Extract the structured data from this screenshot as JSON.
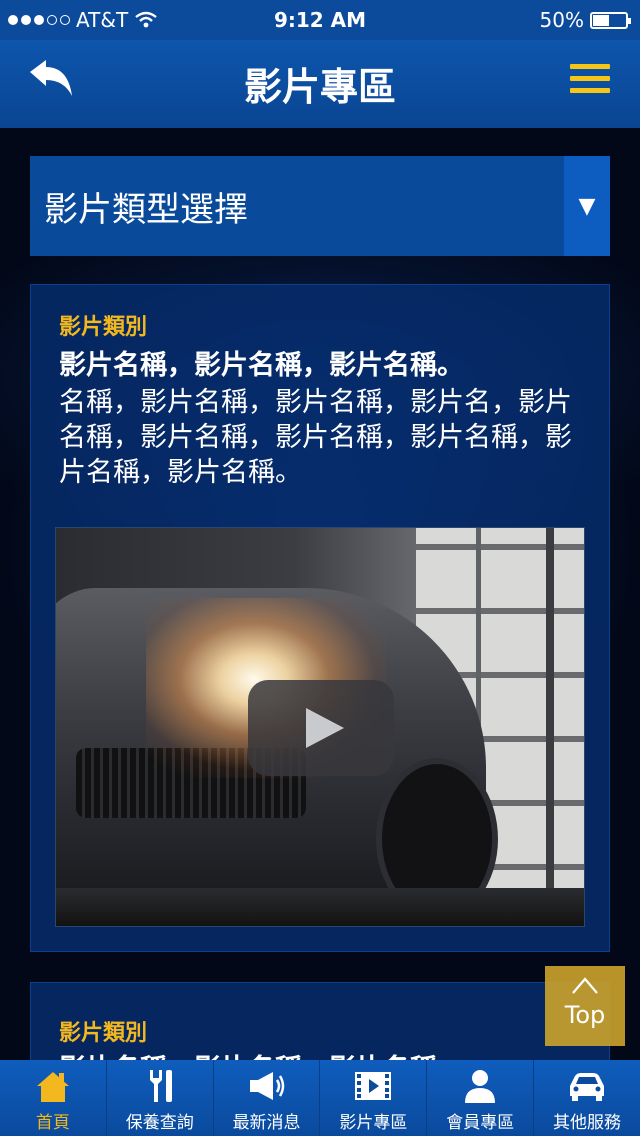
{
  "status_bar": {
    "carrier": "AT&T",
    "time": "9:12 AM",
    "battery": "50%",
    "battery_level": 0.5
  },
  "nav": {
    "title": "影片專區",
    "back_icon": "back-arrow-icon",
    "menu_icon": "hamburger-menu-icon"
  },
  "colors": {
    "primary": "#0c4a9c",
    "accent": "#f3b71f"
  },
  "filter": {
    "label": "影片類型選擇",
    "arrow": "▼"
  },
  "videos": [
    {
      "category": "影片類別",
      "title": "影片名稱，影片名稱，影片名稱。",
      "description": "名稱，影片名稱，影片名稱，影片名，影片名稱，影片名稱，影片名稱，影片名稱，影片名稱，影片名稱。"
    },
    {
      "category": "影片類別",
      "title": "影片名稱，影片名稱，影片名稱。"
    }
  ],
  "top_button": {
    "chevron": "^",
    "label": "Top"
  },
  "tabs": [
    {
      "label": "首頁",
      "icon": "home-icon",
      "active": true
    },
    {
      "label": "保養查詢",
      "icon": "tools-icon",
      "active": false
    },
    {
      "label": "最新消息",
      "icon": "megaphone-icon",
      "active": false
    },
    {
      "label": "影片專區",
      "icon": "video-icon",
      "active": false
    },
    {
      "label": "會員專區",
      "icon": "user-icon",
      "active": false
    },
    {
      "label": "其他服務",
      "icon": "car-icon",
      "active": false
    }
  ]
}
